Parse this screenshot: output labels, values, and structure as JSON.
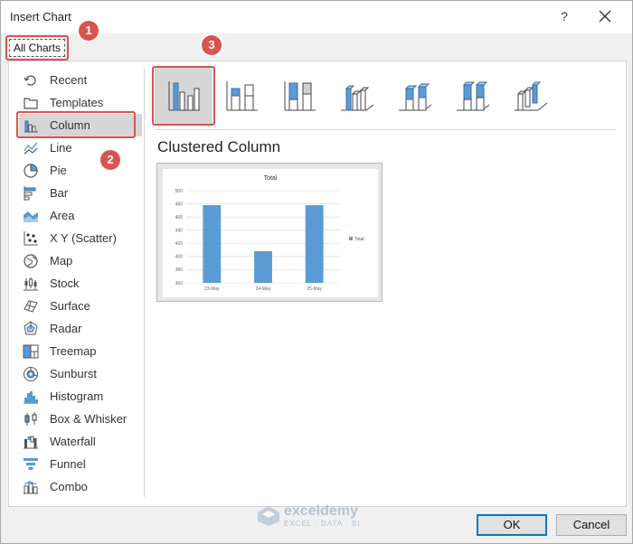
{
  "window": {
    "title": "Insert Chart",
    "help_glyph": "?"
  },
  "tabs": [
    {
      "label": "All Charts",
      "active": true
    }
  ],
  "chart_types": [
    {
      "label": "Recent",
      "icon": "recent-icon"
    },
    {
      "label": "Templates",
      "icon": "templates-icon"
    },
    {
      "label": "Column",
      "icon": "column-chart-icon",
      "selected": true
    },
    {
      "label": "Line",
      "icon": "line-chart-icon"
    },
    {
      "label": "Pie",
      "icon": "pie-chart-icon"
    },
    {
      "label": "Bar",
      "icon": "bar-chart-icon"
    },
    {
      "label": "Area",
      "icon": "area-chart-icon"
    },
    {
      "label": "X Y (Scatter)",
      "icon": "scatter-chart-icon"
    },
    {
      "label": "Map",
      "icon": "map-chart-icon"
    },
    {
      "label": "Stock",
      "icon": "stock-chart-icon"
    },
    {
      "label": "Surface",
      "icon": "surface-chart-icon"
    },
    {
      "label": "Radar",
      "icon": "radar-chart-icon"
    },
    {
      "label": "Treemap",
      "icon": "treemap-chart-icon"
    },
    {
      "label": "Sunburst",
      "icon": "sunburst-chart-icon"
    },
    {
      "label": "Histogram",
      "icon": "histogram-chart-icon"
    },
    {
      "label": "Box & Whisker",
      "icon": "box-whisker-chart-icon"
    },
    {
      "label": "Waterfall",
      "icon": "waterfall-chart-icon"
    },
    {
      "label": "Funnel",
      "icon": "funnel-chart-icon"
    },
    {
      "label": "Combo",
      "icon": "combo-chart-icon"
    }
  ],
  "subtypes": [
    {
      "name": "clustered-column",
      "selected": true
    },
    {
      "name": "stacked-column"
    },
    {
      "name": "100-stacked-column"
    },
    {
      "name": "3d-clustered-column"
    },
    {
      "name": "3d-stacked-column"
    },
    {
      "name": "3d-100-stacked-column"
    },
    {
      "name": "3d-column"
    }
  ],
  "selected_subtype_title": "Clustered Column",
  "badges": {
    "one": "1",
    "two": "2",
    "three": "3"
  },
  "watermark": {
    "name": "exceldemy",
    "tagline": "EXCEL · DATA · BI"
  },
  "buttons": {
    "ok": "OK",
    "cancel": "Cancel"
  },
  "colors": {
    "accent_blue": "#5b9bd5",
    "highlight_red": "#d9534f",
    "selected_gray": "#d6d6d6"
  },
  "chart_data": {
    "type": "bar",
    "title": "Total",
    "categories": [
      "23-May",
      "24-May",
      "25-May"
    ],
    "series": [
      {
        "name": "Total",
        "values": [
          478,
          408,
          478
        ]
      }
    ],
    "ylim": [
      360,
      500
    ],
    "yticks": [
      "360",
      "380",
      "400",
      "420",
      "440",
      "460",
      "480",
      "500"
    ],
    "legend": "right",
    "grid": true
  }
}
